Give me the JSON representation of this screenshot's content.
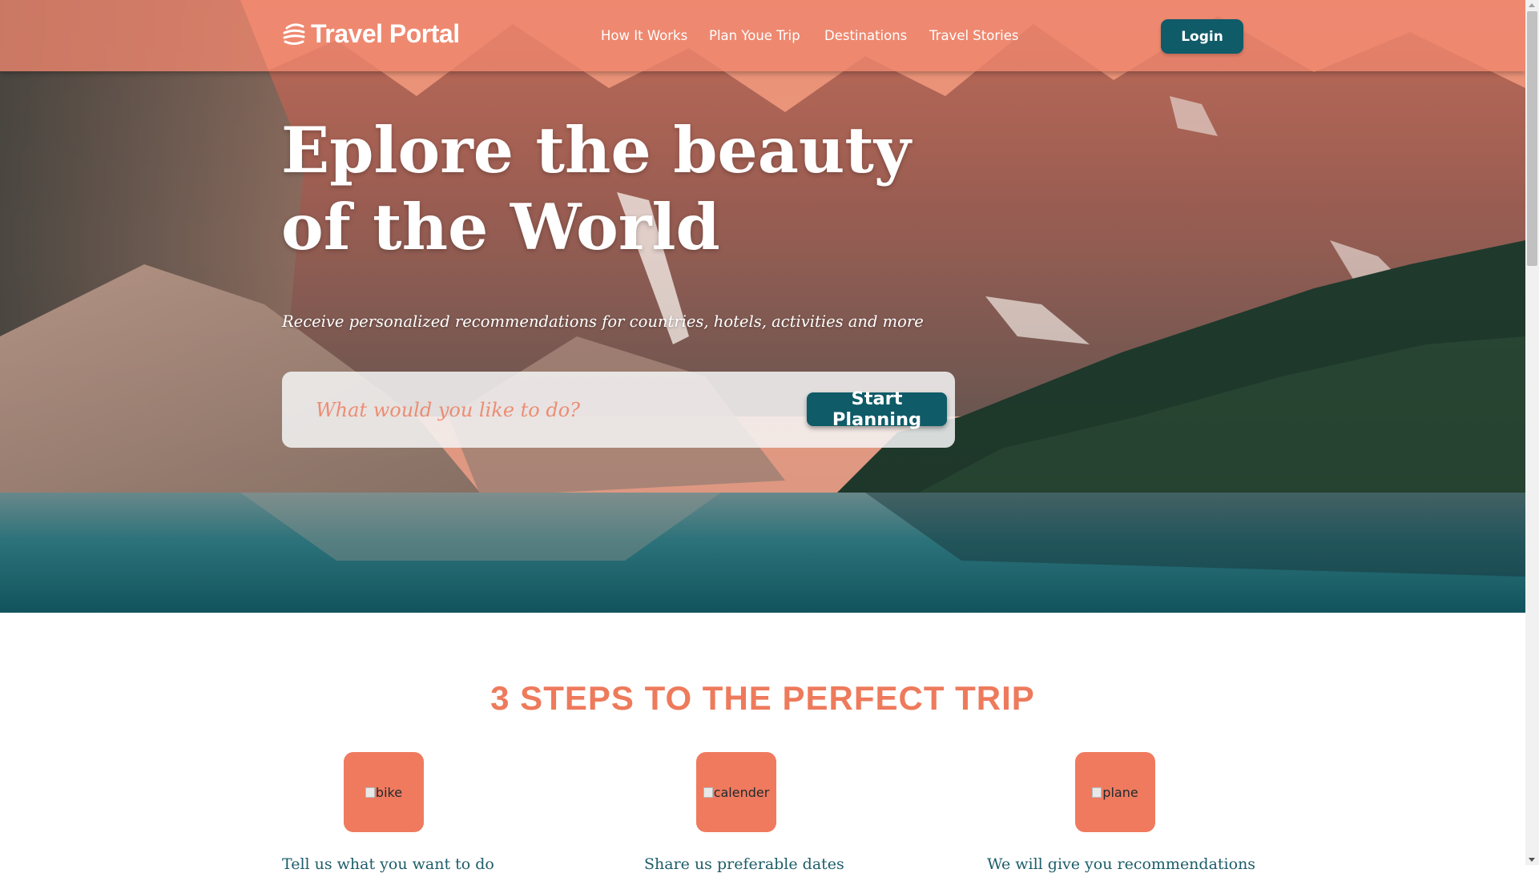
{
  "brand": {
    "name": "Travel Portal",
    "logo_icon": "hamburger-stack-icon"
  },
  "nav": {
    "items": [
      {
        "label": "How It Works"
      },
      {
        "label": "Plan Youe Trip"
      },
      {
        "label": "Destinations"
      },
      {
        "label": "Travel Stories"
      }
    ],
    "login_label": "Login"
  },
  "hero": {
    "title": "Eplore the beauty of the World",
    "subtitle": "Receive personalized recommendations for countries, hotels, activities and more",
    "search_placeholder": "What would you like to do?",
    "search_value": "",
    "cta_label": "Start Planning"
  },
  "steps": {
    "title": "3 STEPS TO THE PERFECT TRIP",
    "items": [
      {
        "icon_alt": "bike",
        "text": "Tell us what you want to do"
      },
      {
        "icon_alt": "calender",
        "text": "Share us preferable dates"
      },
      {
        "icon_alt": "plane",
        "text": "We will give you recommendations"
      }
    ]
  },
  "colors": {
    "accent": "#f07a5e",
    "header_bg": "#f0876e",
    "button_bg": "#0f5b68",
    "step_text": "#1d5d6a",
    "steps_title": "#ee7a5c"
  }
}
